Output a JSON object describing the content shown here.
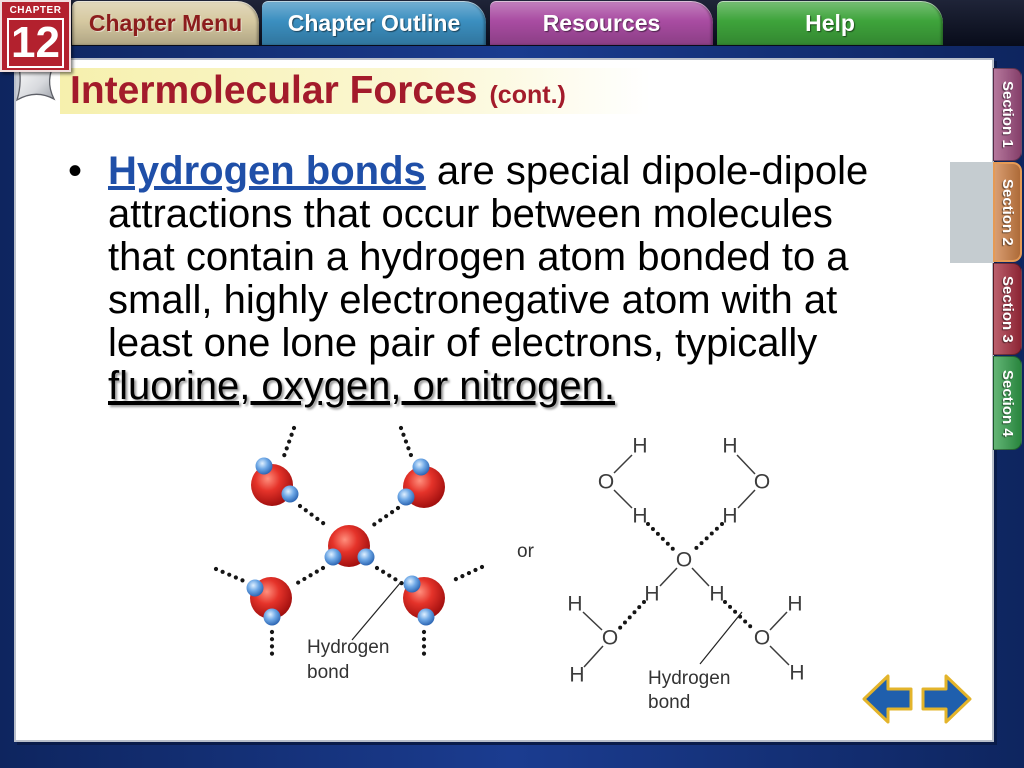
{
  "badge": {
    "label": "CHAPTER",
    "number": "12",
    "color": "#b3212e"
  },
  "top_tabs": [
    {
      "label": "Chapter Menu",
      "color": "#d6c9a1"
    },
    {
      "label": "Chapter Outline",
      "color": "#3b8fc0"
    },
    {
      "label": "Resources",
      "color": "#a94ca2"
    },
    {
      "label": "Help",
      "color": "#3ea43b"
    }
  ],
  "slide": {
    "title": "Intermolecular Forces",
    "title_suffix": "(cont.)",
    "title_color": "#a31b2b",
    "bullet": {
      "term": "Hydrogen bonds",
      "text": "are special dipole-dipole attractions that occur between molecules that contain a hydrogen atom bonded to a small, highly electronegative atom with at least one lone pair of electrons, typically",
      "emphasis": "fluorine, oxygen, or nitrogen.",
      "term_color": "#1f4fa8"
    }
  },
  "figure": {
    "left": {
      "label": [
        "Hydrogen",
        "bond"
      ]
    },
    "separator": "or",
    "right": {
      "atoms": [
        "H",
        "O",
        "H",
        "H",
        "O",
        "H",
        "O",
        "H",
        "H",
        "H",
        "O",
        "H",
        "H",
        "O",
        "H"
      ],
      "label": [
        "Hydrogen",
        "bond"
      ]
    }
  },
  "section_tabs": [
    {
      "label": "Section 1",
      "color": "#9c4a7c",
      "active": false
    },
    {
      "label": "Section 2",
      "color": "#cc7d42",
      "active": true
    },
    {
      "label": "Section 3",
      "color": "#a42a3c",
      "active": false
    },
    {
      "label": "Section 4",
      "color": "#2f9c48",
      "active": false
    }
  ],
  "icons": {
    "page_curl": "page-curl-icon",
    "previous": "arrow-left-icon",
    "next": "arrow-right-icon",
    "bullet": "bullet-point-icon"
  },
  "nav_colors": {
    "fill": "#1f5fad",
    "outline": "#e3b42b"
  }
}
